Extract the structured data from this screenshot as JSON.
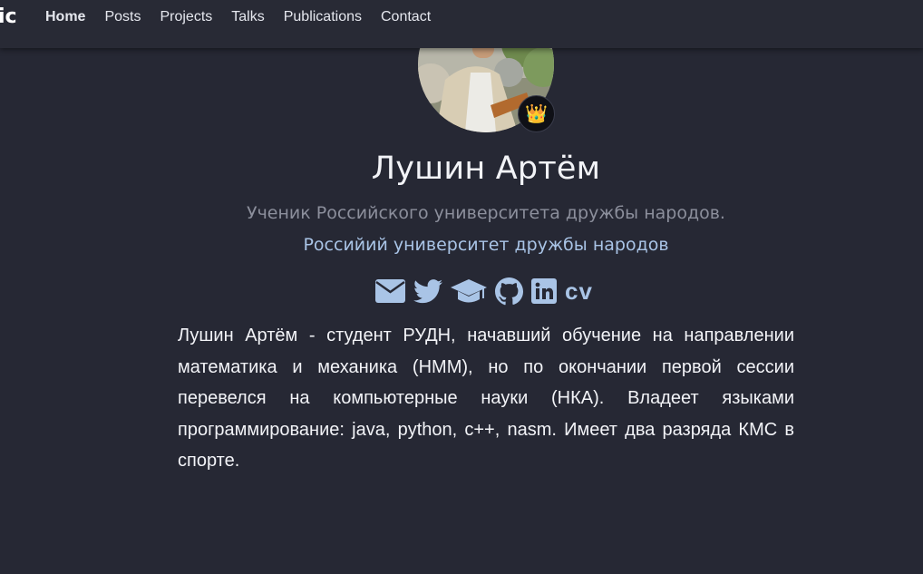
{
  "navbar": {
    "brand": "ic",
    "links": [
      {
        "label": "Home",
        "active": true
      },
      {
        "label": "Posts"
      },
      {
        "label": "Projects"
      },
      {
        "label": "Talks"
      },
      {
        "label": "Publications"
      },
      {
        "label": "Contact"
      }
    ]
  },
  "profile": {
    "avatar_badge": "👑",
    "name": "Лушин Артём",
    "role": "Ученик Российского университета дружбы народов.",
    "organization": "Российий университет дружбы народов",
    "social": [
      {
        "icon": "envelope-icon"
      },
      {
        "icon": "twitter-icon"
      },
      {
        "icon": "graduation-cap-icon"
      },
      {
        "icon": "github-icon"
      },
      {
        "icon": "linkedin-icon"
      }
    ],
    "cv_label": "cv",
    "bio": "Лушин Артём - студент РУДН, начавший обучение на направлении математика и механика (НММ), но по окончании первой сессии перевелся на компьютерные науки (НКА). Владеет языками программирование: java, python, c++, nasm. Имеет два разряда КМС в спорте."
  },
  "colors": {
    "background": "#262834",
    "navbar": "#282a35",
    "accent": "#a9c4e6",
    "muted": "#8c8f9c",
    "text": "#f2f3f7"
  }
}
